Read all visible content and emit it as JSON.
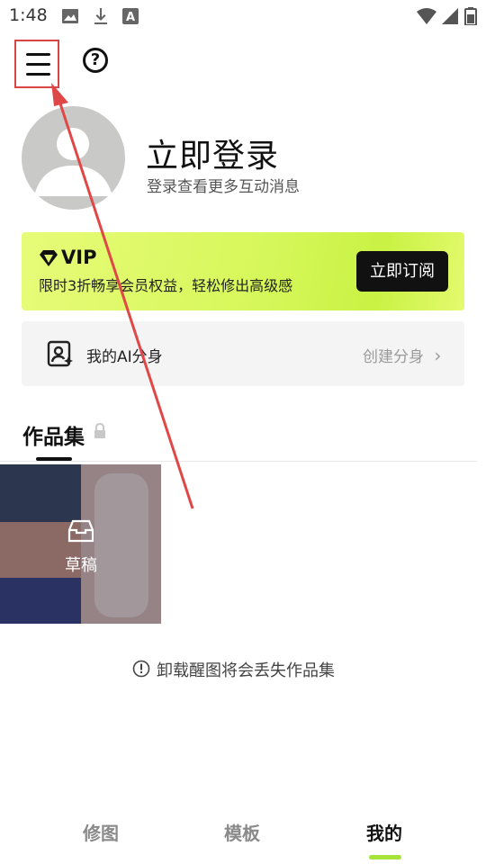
{
  "status_bar": {
    "time": "1:48",
    "icons": [
      "image-icon",
      "download-icon",
      "app-a-icon",
      "wifi-icon",
      "signal-icon",
      "battery-icon"
    ]
  },
  "toolbar": {
    "menu_icon": "hamburger-menu-icon",
    "help_icon": "help-circle-icon",
    "help_glyph": "?"
  },
  "profile": {
    "title": "立即登录",
    "subtitle": "登录查看更多互动消息"
  },
  "vip": {
    "title": "VIP",
    "description": "限时3折畅享会员权益，轻松修出高级感",
    "button": "立即订阅",
    "accent": "#d6f75a"
  },
  "ai_card": {
    "label": "我的AI分身",
    "action": "创建分身",
    "chevron": "›"
  },
  "portfolio": {
    "title": "作品集",
    "draft_label": "草稿",
    "notice": "卸载醒图将会丢失作品集"
  },
  "bottom_nav": {
    "items": [
      "修图",
      "模板",
      "我的"
    ],
    "active": "我的",
    "indicator_color": "#a6e43a"
  },
  "annotation": {
    "color": "#e04848"
  }
}
